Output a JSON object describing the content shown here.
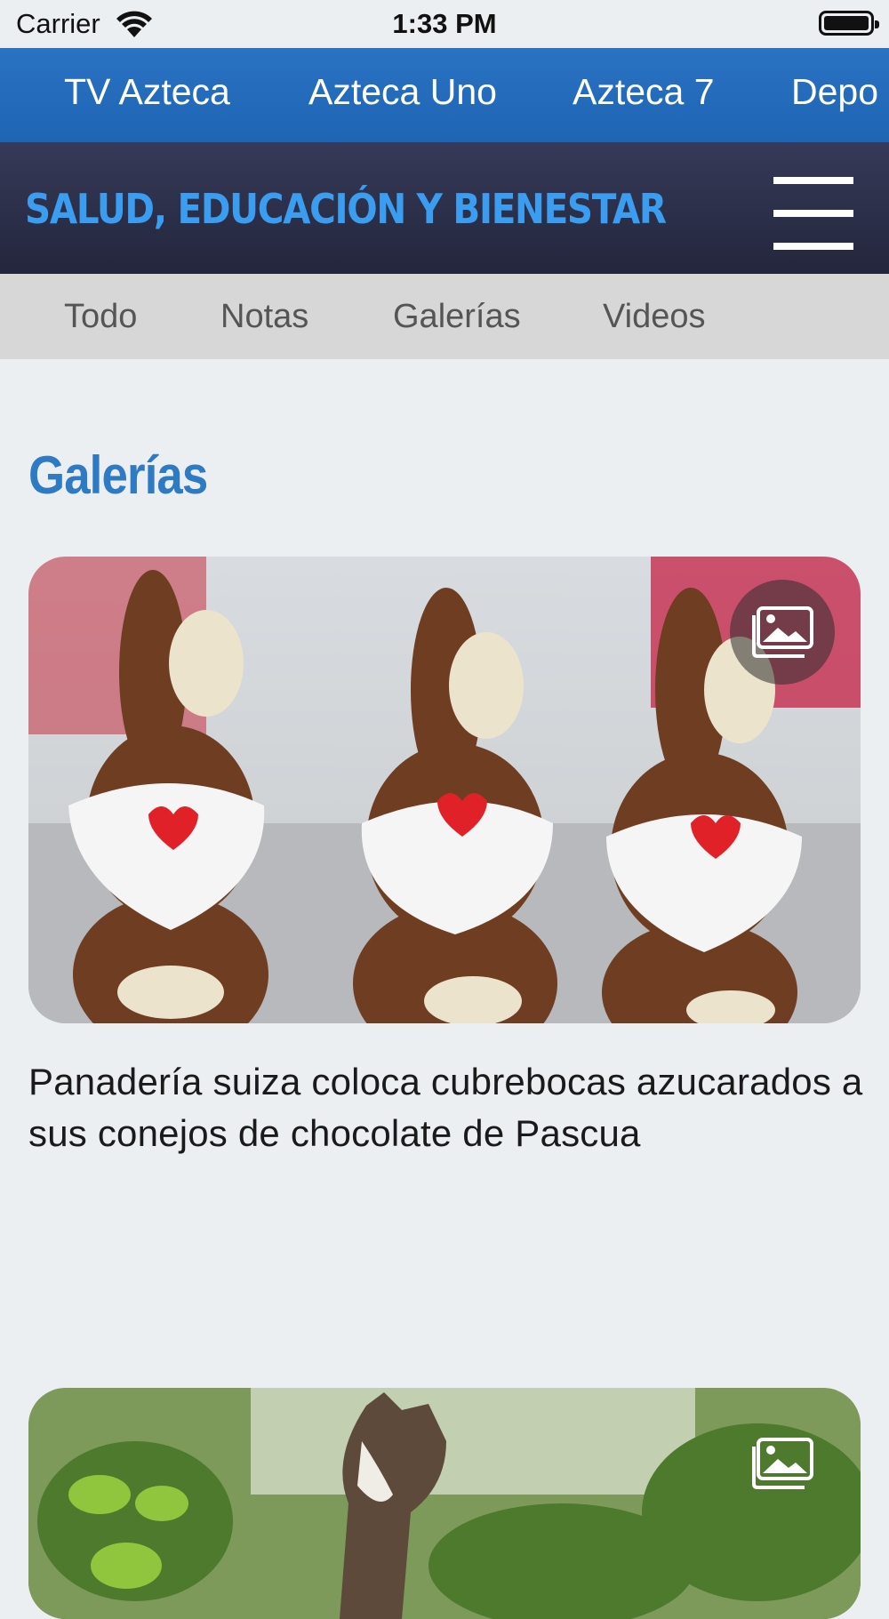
{
  "status_bar": {
    "carrier": "Carrier",
    "time": "1:33 PM"
  },
  "channel_nav": {
    "items": [
      "TV Azteca",
      "Azteca Uno",
      "Azteca 7",
      "Depo"
    ]
  },
  "section": {
    "title": "SALUD, EDUCACIÓN Y BIENESTAR",
    "menu_icon": "hamburger-icon"
  },
  "filter_tabs": {
    "items": [
      "Todo",
      "Notas",
      "Galerías",
      "Videos"
    ]
  },
  "page_heading": "Galerías",
  "cards": [
    {
      "title": "Panadería suiza coloca cubrebocas azucarados a sus conejos de chocolate de Pascua",
      "badge_icon": "gallery-icon"
    },
    {
      "title": "",
      "badge_icon": "gallery-icon"
    }
  ],
  "colors": {
    "channel_bar": "#2a72c2",
    "section_bar": "#2b2e48",
    "section_title": "#3a9df0",
    "heading": "#2f7bc3",
    "tabs_bar": "#d7d7d7",
    "background": "#eceff1"
  }
}
